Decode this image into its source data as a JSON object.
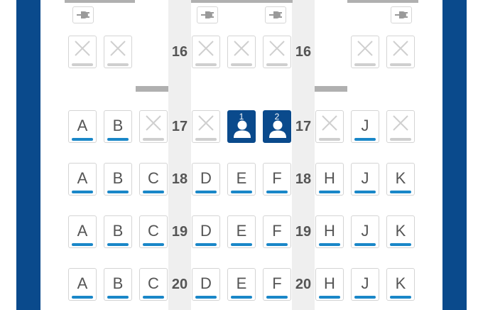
{
  "icons": {
    "outlet": "power-outlet-icon",
    "unavailable": "x-icon",
    "passenger": "person-icon"
  },
  "colors": {
    "wall": "#0a4a8c",
    "aisle": "#efefef",
    "available_bar": "#1a87c8",
    "unavailable_bar": "#cfcfcf",
    "selected": "#0a4a8c"
  },
  "seat_map": {
    "rows": [
      {
        "number": "16",
        "seats": [
          {
            "col": "A",
            "status": "unavailable"
          },
          {
            "col": "B",
            "status": "unavailable"
          },
          {
            "col": "D",
            "status": "unavailable"
          },
          {
            "col": "E",
            "status": "unavailable"
          },
          {
            "col": "F",
            "status": "unavailable"
          },
          {
            "col": "J",
            "status": "unavailable"
          },
          {
            "col": "K",
            "status": "unavailable"
          }
        ]
      },
      {
        "number": "17",
        "seats": [
          {
            "col": "A",
            "label": "A",
            "status": "available"
          },
          {
            "col": "B",
            "label": "B",
            "status": "available"
          },
          {
            "col": "C",
            "status": "unavailable"
          },
          {
            "col": "D",
            "status": "unavailable"
          },
          {
            "col": "E",
            "status": "selected",
            "passenger": "1"
          },
          {
            "col": "F",
            "status": "selected",
            "passenger": "2"
          },
          {
            "col": "H",
            "status": "unavailable"
          },
          {
            "col": "J",
            "label": "J",
            "status": "available"
          },
          {
            "col": "K",
            "status": "unavailable"
          }
        ]
      },
      {
        "number": "18",
        "seats": [
          {
            "col": "A",
            "label": "A",
            "status": "available"
          },
          {
            "col": "B",
            "label": "B",
            "status": "available"
          },
          {
            "col": "C",
            "label": "C",
            "status": "available"
          },
          {
            "col": "D",
            "label": "D",
            "status": "available"
          },
          {
            "col": "E",
            "label": "E",
            "status": "available"
          },
          {
            "col": "F",
            "label": "F",
            "status": "available"
          },
          {
            "col": "H",
            "label": "H",
            "status": "available"
          },
          {
            "col": "J",
            "label": "J",
            "status": "available"
          },
          {
            "col": "K",
            "label": "K",
            "status": "available"
          }
        ]
      },
      {
        "number": "19",
        "seats": [
          {
            "col": "A",
            "label": "A",
            "status": "available"
          },
          {
            "col": "B",
            "label": "B",
            "status": "available"
          },
          {
            "col": "C",
            "label": "C",
            "status": "available"
          },
          {
            "col": "D",
            "label": "D",
            "status": "available"
          },
          {
            "col": "E",
            "label": "E",
            "status": "available"
          },
          {
            "col": "F",
            "label": "F",
            "status": "available"
          },
          {
            "col": "H",
            "label": "H",
            "status": "available"
          },
          {
            "col": "J",
            "label": "J",
            "status": "available"
          },
          {
            "col": "K",
            "label": "K",
            "status": "available"
          }
        ]
      },
      {
        "number": "20",
        "seats": [
          {
            "col": "A",
            "label": "A",
            "status": "available"
          },
          {
            "col": "B",
            "label": "B",
            "status": "available"
          },
          {
            "col": "C",
            "label": "C",
            "status": "available"
          },
          {
            "col": "D",
            "label": "D",
            "status": "available"
          },
          {
            "col": "E",
            "label": "E",
            "status": "available"
          },
          {
            "col": "F",
            "label": "F",
            "status": "available"
          },
          {
            "col": "H",
            "label": "H",
            "status": "available"
          },
          {
            "col": "J",
            "label": "J",
            "status": "available"
          },
          {
            "col": "K",
            "label": "K",
            "status": "available"
          }
        ]
      }
    ]
  }
}
